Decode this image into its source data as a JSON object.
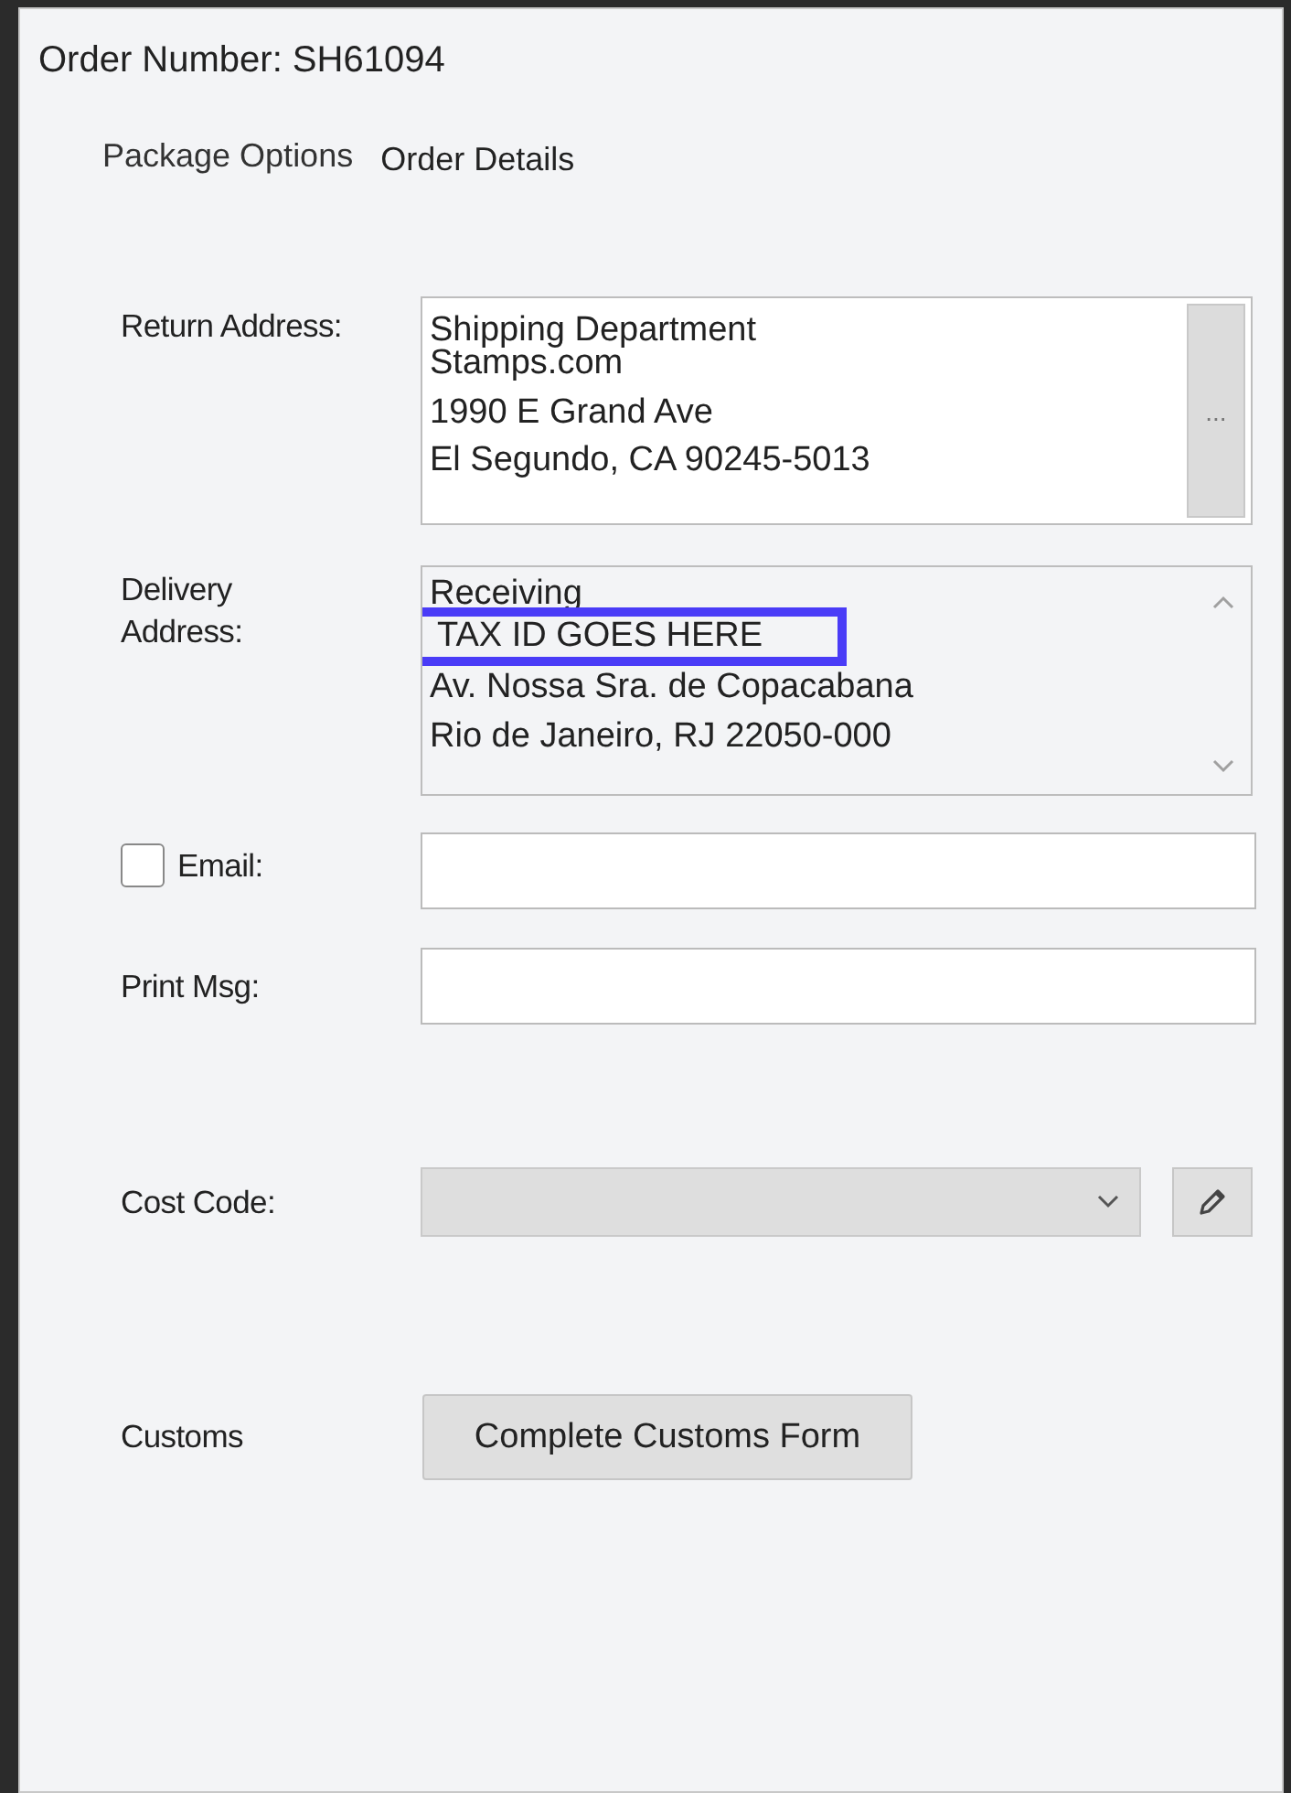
{
  "order_number": "Order Number: SH61094",
  "tabs": [
    {
      "label": "Package Options",
      "selected": false
    },
    {
      "label": "Order Details",
      "selected": true
    }
  ],
  "return_address": {
    "label": "Return Address:",
    "lines": [
      "Shipping Department",
      "Stamps.com",
      "1990 E Grand Ave",
      "El Segundo, CA 90245-5013"
    ],
    "button": "..."
  },
  "delivery_address": {
    "label": "Delivery Address:",
    "lines": [
      {
        "text": "Receiving",
        "highlighted": false
      },
      {
        "text": "TAX ID GOES HERE",
        "highlighted": true
      },
      {
        "text": "Av. Nossa Sra. de Copacabana",
        "highlighted": false
      },
      {
        "text": "Rio de Janeiro, RJ 22050-000",
        "highlighted": false
      }
    ]
  },
  "email": {
    "label": "Email:",
    "checked": false
  },
  "print_msg": {
    "label": "Print Msg:"
  },
  "cost_code": {
    "label": "Cost Code:",
    "disabled": true
  },
  "customs": {
    "label": "Customs",
    "button": "Complete Customs Form"
  }
}
